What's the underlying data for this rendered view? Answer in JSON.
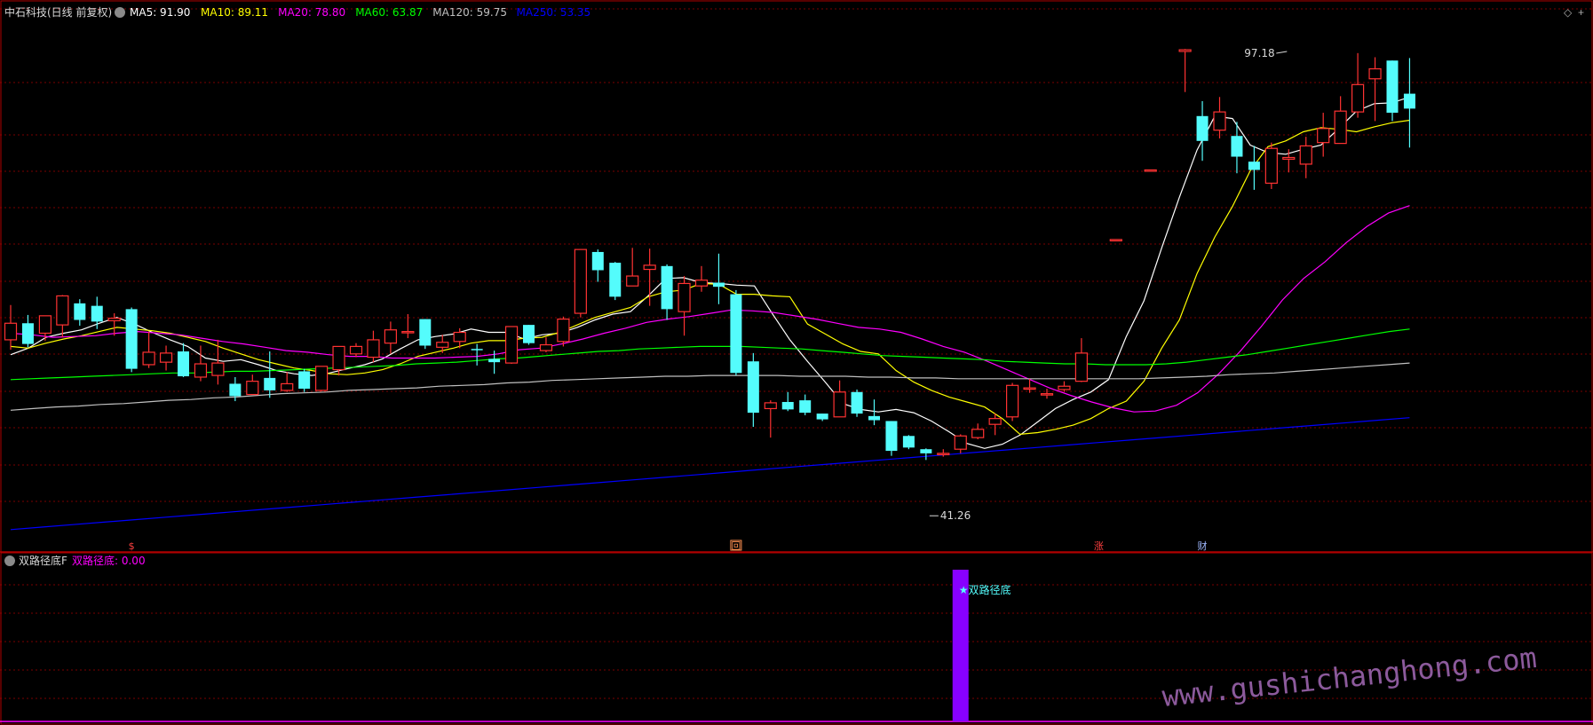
{
  "window": {
    "title": "中石科技(日线 前复权)",
    "indicator_name": "双路径底F"
  },
  "colors": {
    "up": "#ff3232",
    "down": "#54fcfc",
    "ma5": "#ffffff",
    "ma10": "#ffff00",
    "ma20": "#ff00ff",
    "ma60": "#00ff00",
    "ma120": "#c0c0c0",
    "ma250": "#0000ff",
    "grid": "#7a0000",
    "border": "#b00000",
    "signal": "#8800ff",
    "watermark": "#8c5a9c"
  },
  "chart_data": [
    {
      "type": "candlestick",
      "title": "中石科技(日线 前复权)",
      "ylim": [
        37,
        102
      ],
      "legend": [
        {
          "label": "MA5: 91.90",
          "color": "#ffffff"
        },
        {
          "label": "MA10: 89.11",
          "color": "#ffff00"
        },
        {
          "label": "MA20: 78.80",
          "color": "#ff00ff"
        },
        {
          "label": "MA60: 63.87",
          "color": "#00ff00"
        },
        {
          "label": "MA120: 59.75",
          "color": "#c0c0c0"
        },
        {
          "label": "MA250: 53.35",
          "color": "#0000ff"
        }
      ],
      "candles": [
        [
          62.6,
          64.6,
          66.8,
          61.4
        ],
        [
          64.6,
          62.1,
          65.6,
          61.7
        ],
        [
          63.4,
          65.5,
          65.5,
          62.5
        ],
        [
          64.4,
          67.9,
          68.0,
          62.9
        ],
        [
          67.0,
          65.0,
          67.5,
          64.3
        ],
        [
          66.7,
          64.8,
          67.8,
          63.9
        ],
        [
          64.9,
          65.2,
          65.8,
          63.1
        ],
        [
          66.3,
          59.1,
          66.5,
          58.7
        ],
        [
          59.6,
          61.1,
          63.6,
          59.2
        ],
        [
          59.9,
          61.0,
          61.9,
          58.9
        ],
        [
          61.2,
          58.2,
          62.2,
          58.1
        ],
        [
          58.1,
          59.7,
          61.9,
          57.6
        ],
        [
          58.3,
          59.8,
          62.6,
          57.2
        ],
        [
          57.3,
          55.8,
          58.1,
          55.2
        ],
        [
          56.0,
          57.6,
          58.4,
          56.0
        ],
        [
          58.0,
          56.5,
          61.2,
          55.6
        ],
        [
          56.5,
          57.3,
          58.7,
          56.3
        ],
        [
          58.8,
          56.7,
          59.1,
          56.3
        ],
        [
          56.5,
          59.4,
          59.4,
          56.4
        ],
        [
          59.0,
          61.8,
          61.8,
          58.3
        ],
        [
          60.9,
          61.8,
          62.2,
          60.5
        ],
        [
          60.5,
          62.6,
          63.7,
          59.9
        ],
        [
          62.2,
          63.8,
          64.8,
          60.9
        ],
        [
          63.6,
          63.6,
          65.7,
          62.8
        ],
        [
          65.1,
          61.9,
          65.1,
          61.5
        ],
        [
          61.7,
          62.3,
          63.2,
          61.0
        ],
        [
          62.4,
          63.5,
          64.0,
          61.6
        ],
        [
          61.5,
          61.4,
          62.1,
          59.5
        ],
        [
          60.3,
          59.9,
          61.3,
          58.5
        ],
        [
          59.8,
          64.2,
          64.2,
          59.7
        ],
        [
          64.4,
          62.2,
          64.4,
          62.0
        ],
        [
          61.3,
          62.0,
          62.9,
          61.1
        ],
        [
          62.4,
          65.1,
          65.4,
          61.8
        ],
        [
          65.8,
          73.5,
          73.5,
          65.3
        ],
        [
          73.2,
          71.0,
          73.5,
          69.6
        ],
        [
          71.9,
          67.8,
          72.0,
          67.4
        ],
        [
          69.1,
          70.3,
          73.7,
          69.1
        ],
        [
          71.1,
          71.6,
          73.6,
          66.7
        ],
        [
          71.5,
          66.3,
          71.7,
          65.0
        ],
        [
          66.0,
          69.4,
          70.3,
          63.1
        ],
        [
          69.1,
          69.8,
          71.5,
          68.4
        ],
        [
          69.5,
          69.0,
          73.0,
          66.9
        ],
        [
          68.1,
          58.6,
          68.6,
          58.3
        ],
        [
          60.0,
          53.8,
          61.0,
          52.1
        ],
        [
          54.3,
          55.0,
          55.3,
          50.8
        ],
        [
          55.1,
          54.2,
          56.3,
          54.0
        ],
        [
          55.3,
          53.8,
          56.0,
          53.5
        ],
        [
          53.7,
          53.0,
          53.7,
          52.8
        ],
        [
          53.3,
          56.3,
          57.7,
          53.3
        ],
        [
          56.3,
          53.7,
          56.6,
          53.3
        ],
        [
          53.4,
          52.9,
          55.4,
          52.3
        ],
        [
          52.8,
          49.2,
          52.8,
          48.6
        ],
        [
          51.0,
          49.6,
          51.1,
          49.4
        ],
        [
          49.4,
          48.9,
          49.5,
          48.1
        ],
        [
          48.9,
          48.9,
          49.4,
          48.5
        ],
        [
          49.4,
          51.0,
          51.2,
          48.9
        ],
        [
          50.8,
          51.8,
          52.5,
          50.6
        ],
        [
          52.4,
          53.1,
          53.7,
          51.1
        ],
        [
          53.3,
          57.1,
          57.4,
          52.8
        ],
        [
          56.8,
          56.8,
          57.9,
          56.2
        ],
        [
          56.1,
          56.1,
          56.7,
          55.5
        ],
        [
          56.6,
          57.0,
          57.6,
          56.3
        ],
        [
          57.6,
          61.0,
          62.8,
          57.5
        ],
        [
          null,
          null,
          null,
          null
        ],
        [
          74.7,
          74.7,
          74.7,
          74.7
        ],
        [
          null,
          null,
          null,
          null
        ],
        [
          83.1,
          83.1,
          83.1,
          83.1
        ],
        [
          null,
          null,
          null,
          null
        ],
        [
          97.4,
          97.6,
          97.7,
          92.5
        ],
        [
          89.6,
          86.6,
          91.4,
          84.2
        ],
        [
          87.9,
          90.1,
          91.9,
          86.9
        ],
        [
          87.2,
          84.7,
          88.9,
          82.7
        ],
        [
          84.1,
          83.1,
          86.0,
          80.7
        ],
        [
          81.5,
          85.7,
          86.4,
          80.8
        ],
        [
          84.4,
          84.6,
          85.6,
          82.8
        ],
        [
          83.8,
          86.0,
          87.1,
          82.1
        ],
        [
          86.4,
          88.1,
          90.0,
          84.7
        ],
        [
          86.3,
          90.2,
          92.0,
          86.3
        ],
        [
          90.1,
          93.4,
          97.2,
          89.4
        ],
        [
          94.1,
          95.3,
          96.7,
          89.0
        ],
        [
          96.3,
          90.0,
          96.3,
          89.0
        ],
        [
          92.3,
          90.5,
          96.6,
          85.8
        ]
      ],
      "ma": {
        "MA5": [
          60.8,
          61.6,
          62.9,
          63.4,
          63.8,
          64.6,
          65.3,
          64.5,
          63.5,
          62.6,
          61.8,
          60.4,
          60.0,
          60.2,
          59.6,
          58.9,
          58.5,
          58.3,
          58.6,
          59.1,
          59.6,
          60.3,
          61.5,
          62.6,
          63.0,
          63.3,
          63.9,
          63.5,
          63.5,
          62.7,
          63.2,
          63.4,
          64.1,
          65.0,
          65.7,
          66.0,
          67.9,
          70.0,
          70.1,
          69.5,
          69.4,
          69.2,
          69.1,
          65.8,
          62.6,
          60.0,
          57.5,
          54.9,
          54.2,
          53.9,
          54.2,
          53.8,
          52.8,
          51.5,
          50.1,
          49.5,
          50.0,
          51.1,
          52.7,
          54.3,
          55.4,
          56.3,
          57.8,
          63.0,
          67.3,
          73.7,
          79.8,
          85.5,
          89.6,
          89.3,
          86.1,
          85.2,
          85.0,
          85.6,
          86.1,
          88.1,
          90.2,
          91.1,
          91.2,
          91.9
        ],
        "MA10": [
          61.8,
          61.6,
          62.2,
          62.7,
          63.1,
          63.6,
          64.1,
          63.9,
          63.7,
          63.4,
          62.9,
          62.4,
          61.6,
          60.9,
          60.2,
          59.7,
          59.2,
          58.9,
          58.5,
          58.4,
          58.6,
          59.0,
          59.7,
          60.6,
          61.1,
          61.6,
          62.2,
          62.5,
          62.5,
          62.8,
          62.9,
          63.5,
          64.4,
          65.3,
          65.9,
          66.5,
          67.8,
          68.4,
          68.6,
          69.4,
          69.3,
          68.1,
          68.1,
          67.9,
          67.8,
          64.5,
          63.3,
          62.1,
          61.2,
          60.9,
          58.9,
          57.5,
          56.5,
          55.7,
          55.1,
          54.5,
          53.1,
          51.2,
          51.4,
          51.8,
          52.3,
          53.1,
          54.3,
          55.2,
          57.6,
          61.6,
          65.0,
          70.6,
          75.0,
          78.7,
          83.0,
          85.9,
          86.6,
          87.7,
          88.2,
          88.0,
          87.7,
          88.3,
          88.8,
          89.1
        ],
        "MA20": [
          63.4,
          63.2,
          62.9,
          63.0,
          63.1,
          63.4,
          63.6,
          63.4,
          63.2,
          62.8,
          62.4,
          62.1,
          61.7,
          61.3,
          61.1,
          60.8,
          60.6,
          60.6,
          60.4,
          60.4,
          60.4,
          60.5,
          60.6,
          60.9,
          61.4,
          61.6,
          62.1,
          62.7,
          63.4,
          64.0,
          64.7,
          65.1,
          65.4,
          65.8,
          66.2,
          66.1,
          65.9,
          65.5,
          65.1,
          64.6,
          64.1,
          63.9,
          63.5,
          62.7,
          61.8,
          61.1,
          60.1,
          59.0,
          57.9,
          56.8,
          55.9,
          55.1,
          54.4,
          53.9,
          54.0,
          54.7,
          56.2,
          58.5,
          61.2,
          64.2,
          67.4,
          70.0,
          72.0,
          74.3,
          76.3,
          77.9,
          78.8
        ],
        "MA60": [
          57.8,
          57.9,
          58.0,
          58.1,
          58.2,
          58.3,
          58.4,
          58.5,
          58.6,
          58.6,
          58.7,
          58.8,
          58.8,
          58.9,
          59.0,
          59.1,
          59.2,
          59.3,
          59.4,
          59.5,
          59.7,
          59.8,
          59.9,
          60.1,
          60.3,
          60.4,
          60.6,
          60.8,
          61.0,
          61.2,
          61.3,
          61.5,
          61.6,
          61.7,
          61.8,
          61.8,
          61.8,
          61.7,
          61.6,
          61.5,
          61.3,
          61.1,
          60.9,
          60.7,
          60.6,
          60.5,
          60.4,
          60.3,
          60.2,
          60.0,
          59.9,
          59.8,
          59.7,
          59.7,
          59.6,
          59.6,
          59.6,
          59.7,
          59.9,
          60.2,
          60.5,
          60.8,
          61.2,
          61.6,
          62.0,
          62.4,
          62.8,
          63.2,
          63.6,
          63.9
        ],
        "MA120": [
          54.1,
          54.3,
          54.5,
          54.6,
          54.8,
          54.9,
          55.1,
          55.3,
          55.4,
          55.6,
          55.7,
          55.9,
          56.1,
          56.2,
          56.3,
          56.5,
          56.6,
          56.7,
          56.8,
          57.0,
          57.1,
          57.2,
          57.4,
          57.5,
          57.7,
          57.8,
          57.9,
          58.0,
          58.1,
          58.2,
          58.2,
          58.3,
          58.3,
          58.3,
          58.3,
          58.2,
          58.2,
          58.2,
          58.1,
          58.1,
          58.0,
          58.0,
          57.9,
          57.9,
          57.9,
          57.9,
          57.9,
          57.9,
          57.9,
          57.9,
          57.9,
          58.0,
          58.1,
          58.2,
          58.4,
          58.5,
          58.6,
          58.8,
          59.0,
          59.2,
          59.4,
          59.6,
          59.8
        ],
        "MA250": [
          39.7,
          40.0,
          40.3,
          40.6,
          40.9,
          41.2,
          41.5,
          41.8,
          42.1,
          42.4,
          42.7,
          43.0,
          43.3,
          43.6,
          43.9,
          44.2,
          44.5,
          44.8,
          45.1,
          45.4,
          45.7,
          46.0,
          46.3,
          46.6,
          46.9,
          47.2,
          47.5,
          47.8,
          48.1,
          48.4,
          48.7,
          49.0,
          49.3,
          49.6,
          49.9,
          50.2,
          50.5,
          50.8,
          51.1,
          51.4,
          51.7,
          52.0,
          52.3,
          52.6,
          52.9,
          53.2
        ]
      },
      "annotations": [
        {
          "label": "97.18",
          "x": 74,
          "y": 97.18
        },
        {
          "label": "41.26",
          "x": 53,
          "y": 41.26
        }
      ],
      "event_markers": [
        {
          "label": "$",
          "x": 7
        },
        {
          "label": "回",
          "x": 42
        },
        {
          "label": "涨",
          "x": 63
        },
        {
          "label": "财",
          "x": 69
        }
      ]
    },
    {
      "type": "bar",
      "title": "双路径底F",
      "legend": [
        {
          "label": "双路径底: 0.00",
          "color": "#ff00ff"
        }
      ],
      "x": [
        55
      ],
      "values": [
        1
      ],
      "annotations": [
        {
          "label": "★双路径底",
          "x": 55
        }
      ]
    }
  ],
  "watermark": "www.gushichanghong.com"
}
